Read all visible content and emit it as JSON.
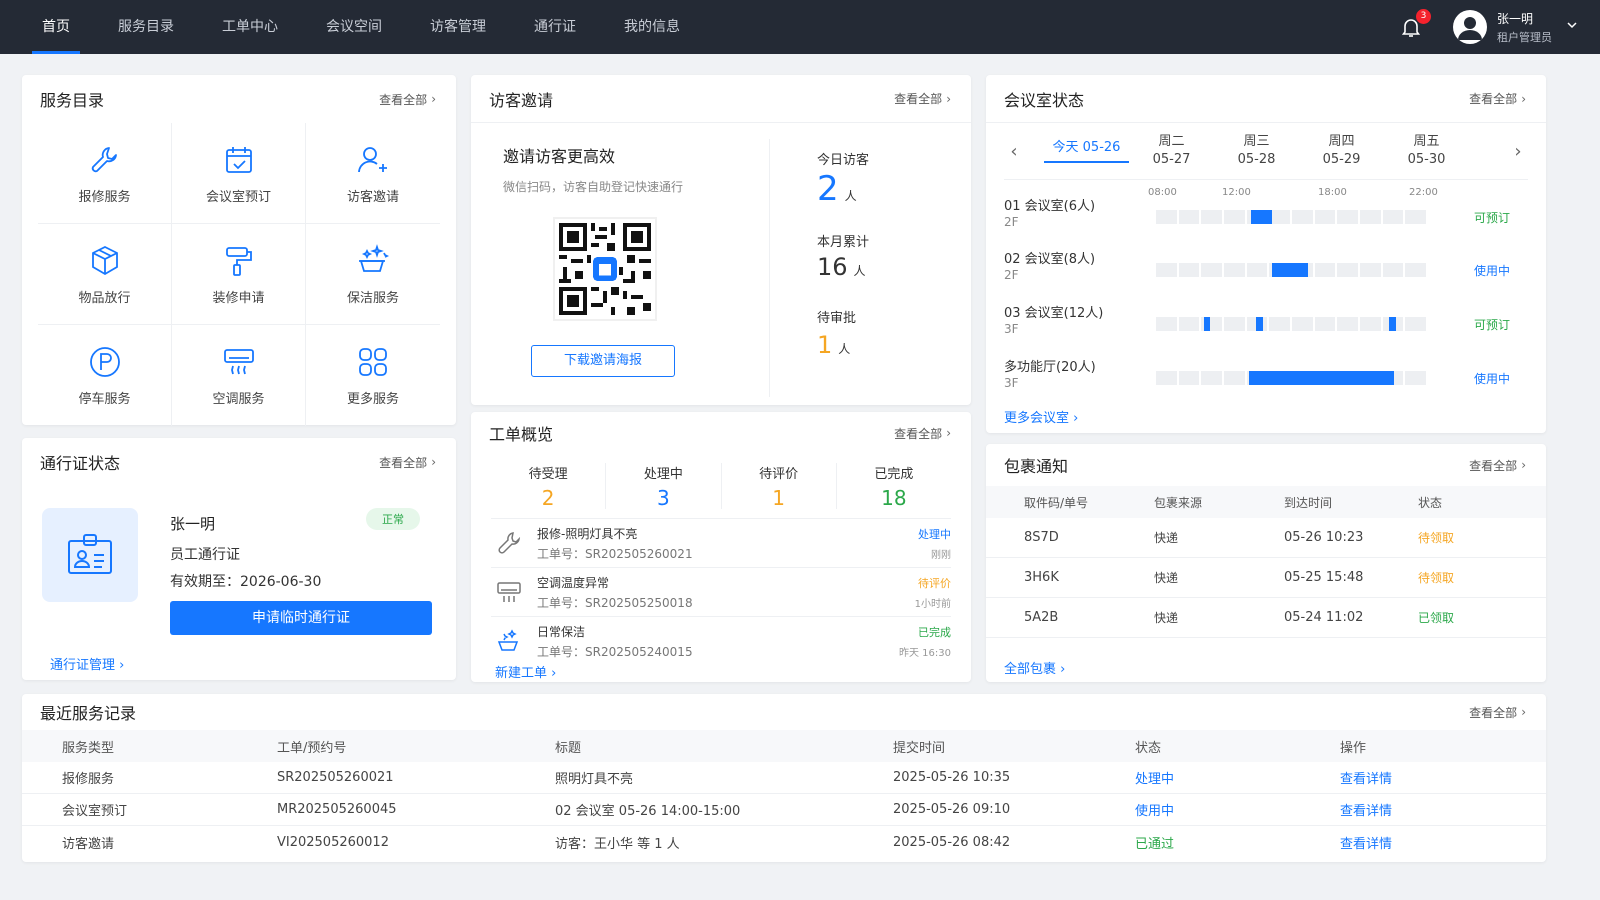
{
  "nav": {
    "items": [
      "首页",
      "服务目录",
      "工单中心",
      "会议空间",
      "访客管理",
      "通行证",
      "我的信息"
    ],
    "notification_count": "3",
    "user_name": "张一明",
    "user_role": "租户管理员"
  },
  "colors": {
    "primary": "#1677ff",
    "orange": "#f5a623",
    "green": "#2ba84a",
    "topbar": "#242a35"
  },
  "services": {
    "title": "服务目录",
    "more": "查看全部",
    "items": [
      {
        "label": "报修服务",
        "icon": "wrench-icon"
      },
      {
        "label": "会议室预订",
        "icon": "calendar-check-icon"
      },
      {
        "label": "访客邀请",
        "icon": "user-add-icon"
      },
      {
        "label": "物品放行",
        "icon": "package-icon"
      },
      {
        "label": "装修申请",
        "icon": "paint-roller-icon"
      },
      {
        "label": "保洁服务",
        "icon": "cleaning-icon"
      },
      {
        "label": "停车服务",
        "icon": "parking-icon"
      },
      {
        "label": "空调服务",
        "icon": "air-conditioner-icon"
      },
      {
        "label": "更多服务",
        "icon": "grid-icon"
      }
    ]
  },
  "pass": {
    "title": "通行证状态",
    "more": "查看全部",
    "name": "张一明",
    "badge": "正常",
    "type": "员工通行证",
    "valid": "有效期至：2026-06-30",
    "button": "申请临时通行证",
    "manage_link": "通行证管理"
  },
  "visitor": {
    "title": "访客邀请",
    "more": "查看全部",
    "subtitle": "邀请访客更高效",
    "desc": "微信扫码，访客自助登记快速通行",
    "button": "下载邀请海报",
    "today_label": "今日访客",
    "today_value": "2",
    "month_label": "本月累计",
    "month_value": "16",
    "pending_label": "待审批",
    "pending_value": "1",
    "unit": "人"
  },
  "workorders": {
    "title": "工单概览",
    "more": "查看全部",
    "stats": [
      {
        "label": "待受理",
        "value": "2",
        "color": "#f5a623"
      },
      {
        "label": "处理中",
        "value": "3",
        "color": "#1677ff"
      },
      {
        "label": "待评价",
        "value": "1",
        "color": "#f5a623"
      },
      {
        "label": "已完成",
        "value": "18",
        "color": "#2ba84a"
      }
    ],
    "items": [
      {
        "title": "报修-照明灯具不亮",
        "no": "工单号：SR202505260021",
        "status": "处理中",
        "status_color": "#1677ff",
        "time": "刚刚",
        "icon": "wrench-icon"
      },
      {
        "title": "空调温度异常",
        "no": "工单号：SR202505250018",
        "status": "待评价",
        "status_color": "#f5a623",
        "time": "1小时前",
        "icon": "air-conditioner-icon"
      },
      {
        "title": "日常保洁",
        "no": "工单号：SR202505240015",
        "status": "已完成",
        "status_color": "#2ba84a",
        "time": "昨天 16:30",
        "icon": "cleaning-icon"
      }
    ],
    "new_link": "新建工单"
  },
  "meeting": {
    "title": "会议室状态",
    "more": "查看全部",
    "days": [
      {
        "week": "今天 05-26",
        "date": "",
        "today": true
      },
      {
        "week": "周二",
        "date": "05-27"
      },
      {
        "week": "周三",
        "date": "05-28"
      },
      {
        "week": "周四",
        "date": "05-29"
      },
      {
        "week": "周五",
        "date": "05-30"
      }
    ],
    "hours": [
      "08:00",
      "12:00",
      "18:00",
      "22:00"
    ],
    "rooms": [
      {
        "name": "01 会议室(6人)",
        "floor": "2F",
        "status": "可预订",
        "status_color": "#2ba84a",
        "busy": [
          [
            4.2,
            5.1
          ]
        ]
      },
      {
        "name": "02 会议室(8人)",
        "floor": "2F",
        "status": "使用中",
        "status_color": "#1677ff",
        "busy": [
          [
            5.1,
            6.7
          ]
        ]
      },
      {
        "name": "03 会议室(12人)",
        "floor": "3F",
        "status": "可预订",
        "status_color": "#2ba84a",
        "busy": [
          [
            2.1,
            2.4
          ],
          [
            4.4,
            4.7
          ],
          [
            10.3,
            10.6
          ]
        ]
      },
      {
        "name": "多功能厅(20人)",
        "floor": "3F",
        "status": "使用中",
        "status_color": "#1677ff",
        "busy": [
          [
            4.1,
            10.5
          ]
        ]
      }
    ],
    "more_link": "更多会议室"
  },
  "packages": {
    "title": "包裹通知",
    "more": "查看全部",
    "columns": [
      "取件码/单号",
      "包裹来源",
      "到达时间",
      "状态"
    ],
    "rows": [
      {
        "code": "8S7D",
        "source": "快递",
        "time": "05-26 10:23",
        "status": "待领取",
        "status_color": "#f5a623"
      },
      {
        "code": "3H6K",
        "source": "快递",
        "time": "05-25 15:48",
        "status": "待领取",
        "status_color": "#f5a623"
      },
      {
        "code": "5A2B",
        "source": "快递",
        "time": "05-24 11:02",
        "status": "已领取",
        "status_color": "#2ba84a"
      }
    ],
    "more_link": "全部包裹"
  },
  "records": {
    "title": "最近服务记录",
    "more": "查看全部",
    "columns": [
      "服务类型",
      "工单/预约号",
      "标题",
      "提交时间",
      "状态",
      "操作"
    ],
    "rows": [
      {
        "type": "报修服务",
        "no": "SR202505260021",
        "title": "照明灯具不亮",
        "time": "2025-05-26 10:35",
        "status": "处理中",
        "status_color": "#1677ff",
        "action": "查看详情"
      },
      {
        "type": "会议室预订",
        "no": "MR202505260045",
        "title": "02 会议室 05-26 14:00-15:00",
        "time": "2025-05-26 09:10",
        "status": "使用中",
        "status_color": "#1677ff",
        "action": "查看详情"
      },
      {
        "type": "访客邀请",
        "no": "VI202505260012",
        "title": "访客：王小华 等 1 人",
        "time": "2025-05-26 08:42",
        "status": "已通过",
        "status_color": "#2ba84a",
        "action": "查看详情"
      }
    ]
  }
}
